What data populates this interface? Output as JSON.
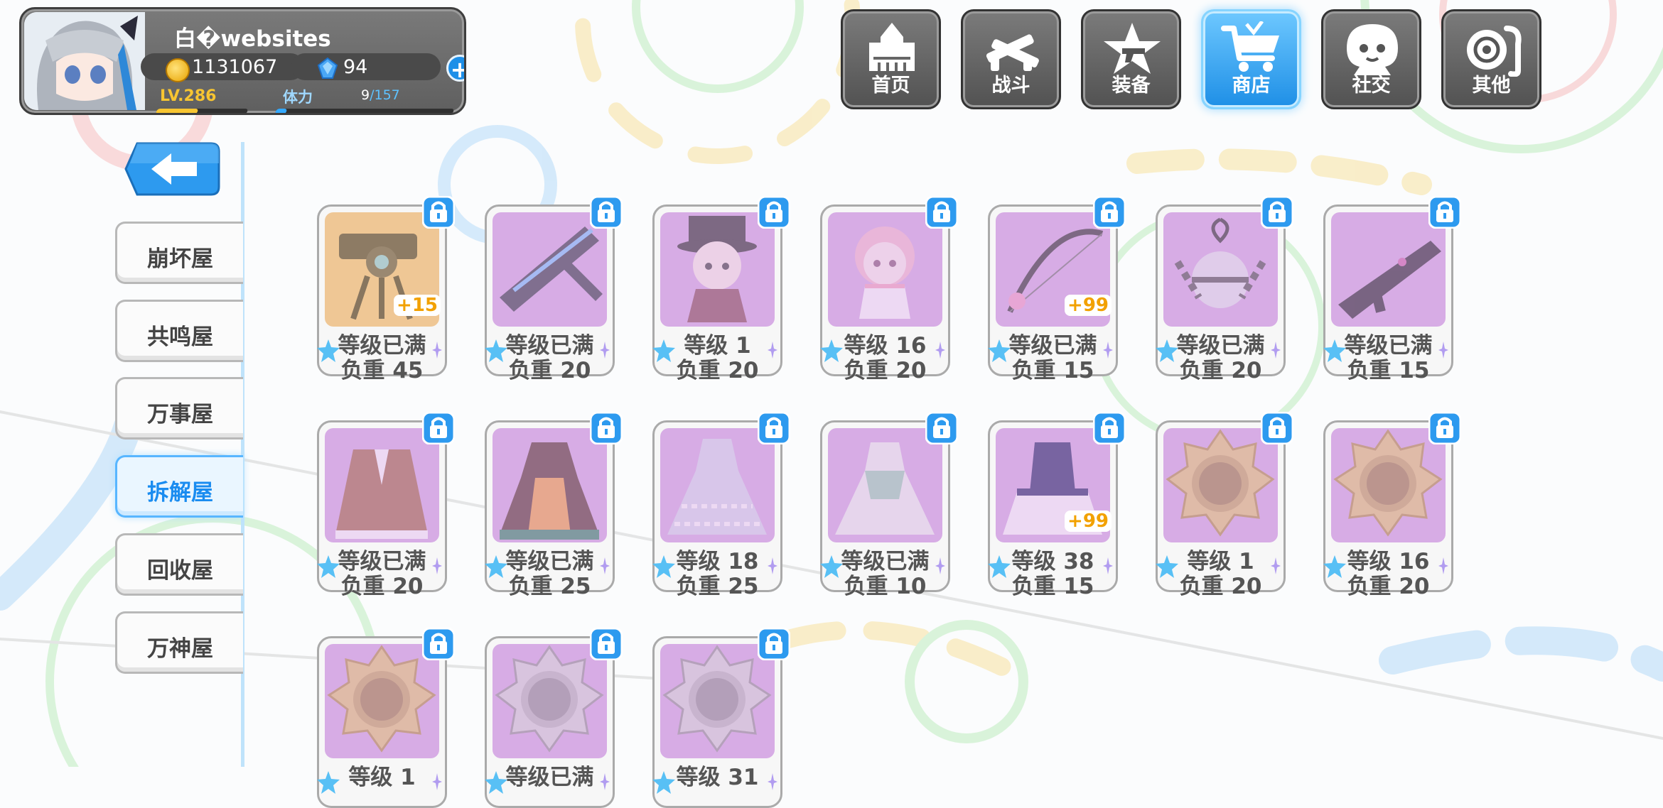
{
  "player": {
    "name": "白�websites",
    "coins": "1131067",
    "gems": "94",
    "level": "LV.286",
    "level_progress": 0.45,
    "stamina_label": "体力",
    "stamina_current": "9",
    "stamina_max": "/157",
    "stamina_progress": 0.06,
    "icons": {
      "coin": "coin-icon",
      "gem": "gem-icon",
      "add": "plus-icon"
    }
  },
  "nav": [
    {
      "label": "首页",
      "icon": "house-icon",
      "active": false
    },
    {
      "label": "战斗",
      "icon": "crossed-guns-icon",
      "active": false
    },
    {
      "label": "装备",
      "icon": "star-gun-icon",
      "active": false
    },
    {
      "label": "商店",
      "icon": "cart-icon",
      "active": true
    },
    {
      "label": "社交",
      "icon": "character-icon",
      "active": false
    },
    {
      "label": "其他",
      "icon": "settings-scroll-icon",
      "active": false
    }
  ],
  "sidebar": {
    "back_icon": "back-arrow-icon",
    "items": [
      {
        "label": "崩坏屋",
        "active": false
      },
      {
        "label": "共鸣屋",
        "active": false
      },
      {
        "label": "万事屋",
        "active": false
      },
      {
        "label": "拆解屋",
        "active": true
      },
      {
        "label": "回收屋",
        "active": false
      },
      {
        "label": "万神屋",
        "active": false
      }
    ]
  },
  "items": [
    {
      "l1": "等级已满",
      "l2": "负重 45",
      "bonus": "+15",
      "art": "turret-weapon"
    },
    {
      "l1": "等级已满",
      "l2": "负重 20",
      "bonus": "",
      "art": "blade-weapon"
    },
    {
      "l1": "等级 1",
      "l2": "负重 20",
      "bonus": "",
      "art": "chibi-hat-girl"
    },
    {
      "l1": "等级 16",
      "l2": "负重 20",
      "bonus": "",
      "art": "chibi-pink-girl"
    },
    {
      "l1": "等级已满",
      "l2": "负重 15",
      "bonus": "+99",
      "art": "bow-weapon"
    },
    {
      "l1": "等级已满",
      "l2": "负重 20",
      "bonus": "",
      "art": "bell-weapon"
    },
    {
      "l1": "等级已满",
      "l2": "负重 15",
      "bonus": "",
      "art": "rifle-weapon"
    },
    {
      "l1": "等级已满",
      "l2": "负重 20",
      "bonus": "",
      "art": "brown-coat"
    },
    {
      "l1": "等级已满",
      "l2": "负重 25",
      "bonus": "",
      "art": "dark-dress"
    },
    {
      "l1": "等级 18",
      "l2": "负重 25",
      "bonus": "",
      "art": "lace-dress"
    },
    {
      "l1": "等级已满",
      "l2": "负重 10",
      "bonus": "",
      "art": "white-dress"
    },
    {
      "l1": "等级 38",
      "l2": "负重 15",
      "bonus": "+99",
      "art": "navy-uniform"
    },
    {
      "l1": "等级 1",
      "l2": "负重 20",
      "bonus": "",
      "art": "gold-badge"
    },
    {
      "l1": "等级 16",
      "l2": "负重 20",
      "bonus": "",
      "art": "gold-badge"
    },
    {
      "l1": "等级 1",
      "l2": "",
      "bonus": "",
      "art": "gold-badge"
    },
    {
      "l1": "等级已满",
      "l2": "",
      "bonus": "",
      "art": "silver-badge"
    },
    {
      "l1": "等级 31",
      "l2": "",
      "bonus": "",
      "art": "silver-badge"
    }
  ],
  "colors": {
    "accent": "#1e8fe6",
    "item_bg": "#d7ace5",
    "bonus": "#f2a100",
    "level": "#f7c531"
  }
}
